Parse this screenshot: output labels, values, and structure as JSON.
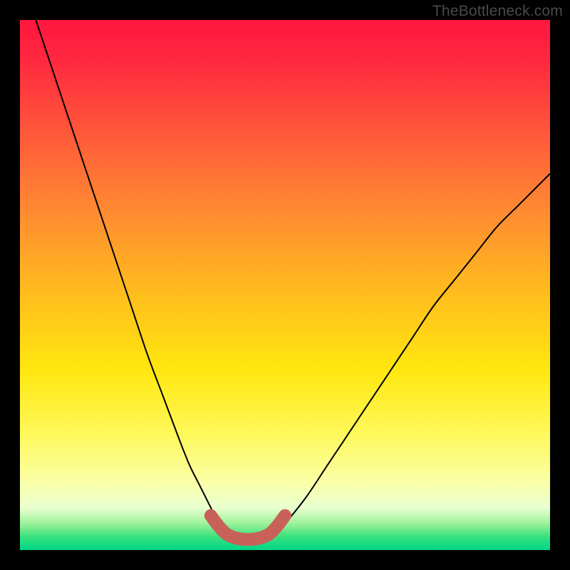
{
  "attribution": "TheBottleneck.com",
  "colors": {
    "page_bg": "#000000",
    "curve": "#000000",
    "bump": "#c86159",
    "gradient_top": "#ff163f",
    "gradient_bottom": "#00d688"
  },
  "chart_data": {
    "type": "line",
    "title": "",
    "xlabel": "",
    "ylabel": "",
    "xlim": [
      0,
      100
    ],
    "ylim": [
      0,
      100
    ],
    "series": [
      {
        "name": "bottleneck-curve",
        "x": [
          3,
          6,
          9,
          12,
          15,
          18,
          21,
          24,
          27,
          30,
          32,
          34,
          36,
          37,
          38,
          40,
          42,
          44,
          46,
          48,
          50,
          54,
          58,
          62,
          66,
          70,
          74,
          78,
          82,
          86,
          90,
          94,
          98,
          100
        ],
        "y": [
          100,
          91,
          82,
          73,
          64,
          55,
          46,
          37,
          29,
          21,
          16,
          12,
          8,
          6,
          5,
          3,
          2,
          2,
          2,
          3,
          5,
          10,
          16,
          22,
          28,
          34,
          40,
          46,
          51,
          56,
          61,
          65,
          69,
          71
        ]
      },
      {
        "name": "optimal-range-marker",
        "x": [
          36,
          37.5,
          39,
          41,
          43,
          45,
          47,
          48.5,
          50
        ],
        "y": [
          6.5,
          4.5,
          3,
          2.2,
          2,
          2.2,
          3,
          4.5,
          6.5
        ]
      }
    ]
  }
}
